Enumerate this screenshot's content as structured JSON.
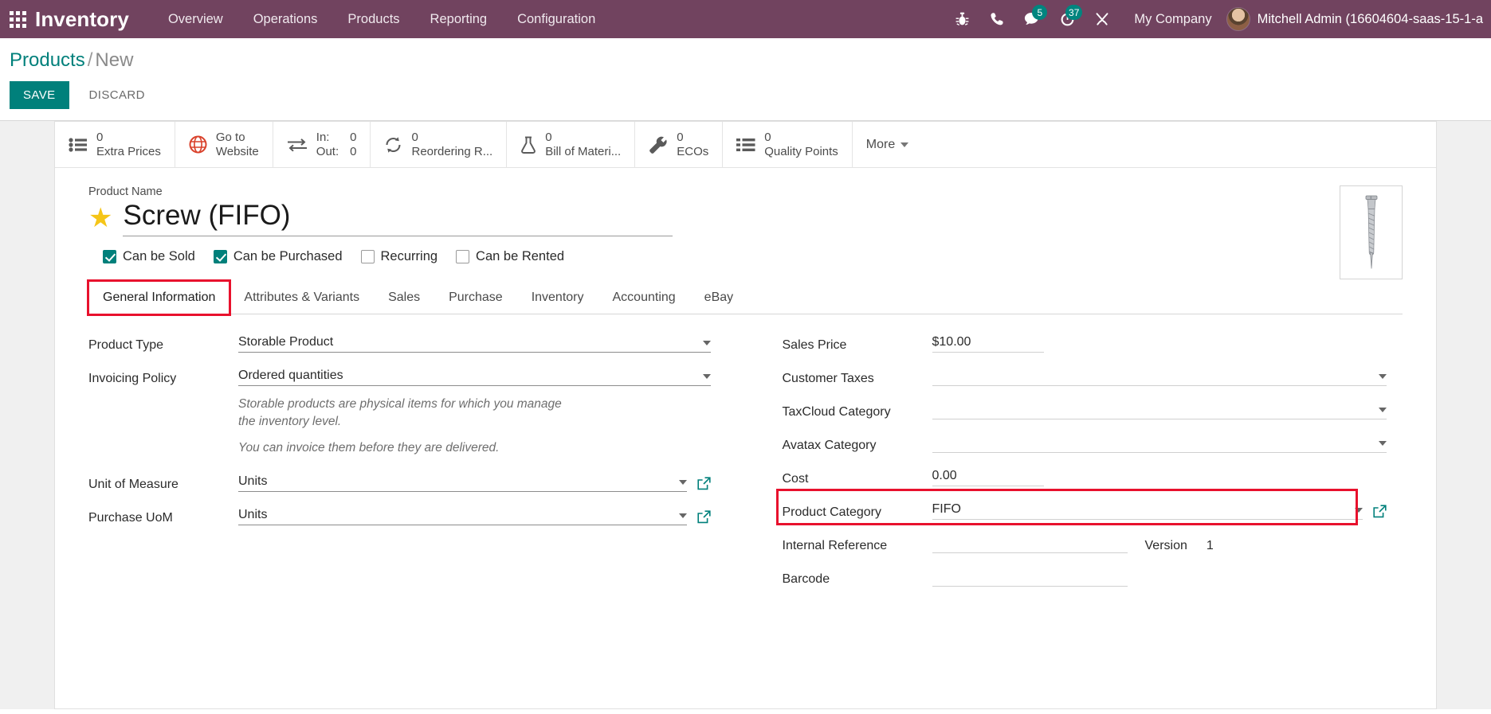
{
  "navbar": {
    "apps_icon": "apps-grid-icon",
    "brand": "Inventory",
    "menu": [
      {
        "label": "Overview"
      },
      {
        "label": "Operations"
      },
      {
        "label": "Products"
      },
      {
        "label": "Reporting"
      },
      {
        "label": "Configuration"
      }
    ],
    "icons": [
      {
        "name": "bug-icon",
        "badge": ""
      },
      {
        "name": "phone-icon",
        "badge": ""
      },
      {
        "name": "messages-icon",
        "badge": "5"
      },
      {
        "name": "activity-clock-icon",
        "badge": "37"
      },
      {
        "name": "tools-icon",
        "badge": ""
      }
    ],
    "company": "My Company",
    "user": "Mitchell Admin (16604604-saas-15-1-a",
    "badge_color": "#00857f",
    "bg_color": "#71435f"
  },
  "control_panel": {
    "breadcrumb_root": "Products",
    "breadcrumb_sep": "/",
    "breadcrumb_current": "New",
    "save_label": "SAVE",
    "discard_label": "DISCARD",
    "save_color": "#00807b"
  },
  "stat_buttons": [
    {
      "name": "extra-prices",
      "icon": "list-icon",
      "value": "0",
      "label": "Extra Prices"
    },
    {
      "name": "go-to-website",
      "icon": "globe-icon",
      "value": "Go to",
      "label": "Website"
    },
    {
      "name": "in-out",
      "icon": "transfer-icon",
      "key1": "In:",
      "key2": "Out:",
      "val1": "0",
      "val2": "0"
    },
    {
      "name": "reordering-rules",
      "icon": "refresh-icon",
      "value": "0",
      "label": "Reordering R..."
    },
    {
      "name": "bill-of-materials",
      "icon": "flask-icon",
      "value": "0",
      "label": "Bill of Materi..."
    },
    {
      "name": "ecos",
      "icon": "wrench-icon",
      "value": "0",
      "label": "ECOs"
    },
    {
      "name": "quality-points",
      "icon": "checklist-icon",
      "value": "0",
      "label": "Quality Points"
    }
  ],
  "more_label": "More",
  "product": {
    "name_label": "Product Name",
    "name_value": "Screw (FIFO)",
    "favorite_icon": "star-icon",
    "image_icon": "screw-image"
  },
  "checkboxes": [
    {
      "label": "Can be Sold",
      "checked": true
    },
    {
      "label": "Can be Purchased",
      "checked": true
    },
    {
      "label": "Recurring",
      "checked": false
    },
    {
      "label": "Can be Rented",
      "checked": false
    }
  ],
  "tabs": [
    {
      "label": "General Information",
      "active": true,
      "highlighted": true
    },
    {
      "label": "Attributes & Variants",
      "active": false,
      "highlighted": false
    },
    {
      "label": "Sales",
      "active": false,
      "highlighted": false
    },
    {
      "label": "Purchase",
      "active": false,
      "highlighted": false
    },
    {
      "label": "Inventory",
      "active": false,
      "highlighted": false
    },
    {
      "label": "Accounting",
      "active": false,
      "highlighted": false
    },
    {
      "label": "eBay",
      "active": false,
      "highlighted": false
    }
  ],
  "left_fields": {
    "product_type_label": "Product Type",
    "product_type_value": "Storable Product",
    "invoicing_policy_label": "Invoicing Policy",
    "invoicing_policy_value": "Ordered quantities",
    "hint1": "Storable products are physical items for which you manage the inventory level.",
    "hint2": "You can invoice them before they are delivered.",
    "uom_label": "Unit of Measure",
    "uom_value": "Units",
    "purchase_uom_label": "Purchase UoM",
    "purchase_uom_value": "Units"
  },
  "right_fields": {
    "sales_price_label": "Sales Price",
    "sales_price_value": "$10.00",
    "customer_taxes_label": "Customer Taxes",
    "customer_taxes_value": "",
    "taxcloud_label": "TaxCloud Category",
    "taxcloud_value": "",
    "avatax_label": "Avatax Category",
    "avatax_value": "",
    "cost_label": "Cost",
    "cost_value": "0.00",
    "product_category_label": "Product Category",
    "product_category_value": "FIFO",
    "internal_reference_label": "Internal Reference",
    "internal_reference_value": "",
    "version_label": "Version",
    "version_value": "1",
    "barcode_label": "Barcode",
    "barcode_value": ""
  },
  "highlight_color": "#e8112d"
}
